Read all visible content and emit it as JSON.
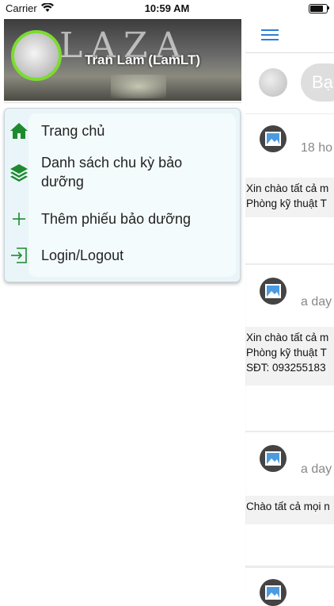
{
  "status_bar": {
    "carrier": "Carrier",
    "time": "10:59 AM",
    "battery_level": 0.9
  },
  "drawer": {
    "profile_name": "Tran Lam (LamLT)",
    "banner_text": "LAZA",
    "menu": [
      {
        "label": "Trang chủ",
        "icon": "home-icon"
      },
      {
        "label": "Danh sách chu kỳ bảo",
        "label2": "dưỡng",
        "icon": "layers-icon"
      },
      {
        "label": "Thêm phiếu bảo dưỡng",
        "icon": "plus-icon"
      },
      {
        "label": "Login/Logout",
        "icon": "login-icon"
      }
    ]
  },
  "feed": {
    "composer_placeholder": "Bạn",
    "posts": [
      {
        "time": "18 ho",
        "lines": [
          "Xin chào tất cả m",
          "Phòng kỹ thuật T"
        ]
      },
      {
        "time": "a day",
        "lines": [
          "Xin chào tất cả m",
          "Phòng kỹ thuật T",
          "SĐT: 093255183"
        ]
      },
      {
        "time": "a day",
        "lines": [
          "Chào tất cả mọi n"
        ]
      },
      {
        "time": "",
        "lines": []
      }
    ]
  },
  "colors": {
    "accent": "#2d7ed8",
    "icon_green": "#1e8a2e",
    "ring": "#7bdc2f",
    "menu_bg": "#e9f5f8"
  }
}
